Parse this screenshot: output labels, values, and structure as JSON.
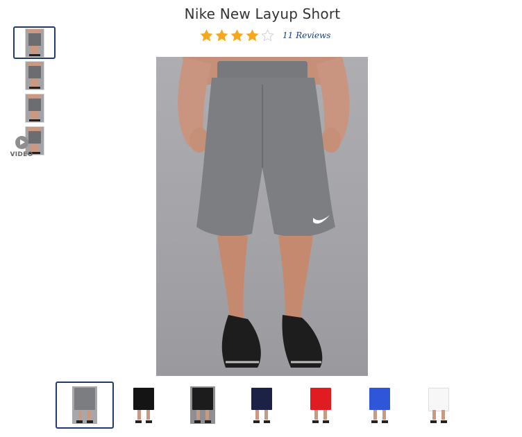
{
  "product": {
    "title": "Nike New Layup Short",
    "rating": 4,
    "rating_max": 5,
    "reviews_label": "11 Reviews"
  },
  "colors": {
    "star_filled": "#f6a71b",
    "star_empty": "#ffffff",
    "selected_border": "#1d3b6e",
    "link": "#1a3d7c"
  },
  "left_thumbnails": [
    {
      "name": "thumb-view-front",
      "selected": true
    },
    {
      "name": "thumb-view-side",
      "selected": false
    },
    {
      "name": "thumb-view-back",
      "selected": false
    },
    {
      "name": "thumb-view-detail",
      "selected": false
    }
  ],
  "video": {
    "label": "VIDEO",
    "icon": "play-icon"
  },
  "color_swatches": [
    {
      "name": "swatch-gray",
      "shorts_color": "#7b7d81",
      "background": "#a8a8ac",
      "selected": true
    },
    {
      "name": "swatch-black",
      "shorts_color": "#141414",
      "background": "#ffffff",
      "selected": false
    },
    {
      "name": "swatch-black-red",
      "shorts_color": "#1c1c1c",
      "background": "#8f8f93",
      "selected": false
    },
    {
      "name": "swatch-navy",
      "shorts_color": "#1b2245",
      "background": "#ffffff",
      "selected": false
    },
    {
      "name": "swatch-red",
      "shorts_color": "#e11b22",
      "background": "#ffffff",
      "selected": false
    },
    {
      "name": "swatch-royal",
      "shorts_color": "#2f56d9",
      "background": "#ffffff",
      "selected": false
    },
    {
      "name": "swatch-white",
      "shorts_color": "#f7f7f7",
      "background": "#ffffff",
      "selected": false
    }
  ]
}
